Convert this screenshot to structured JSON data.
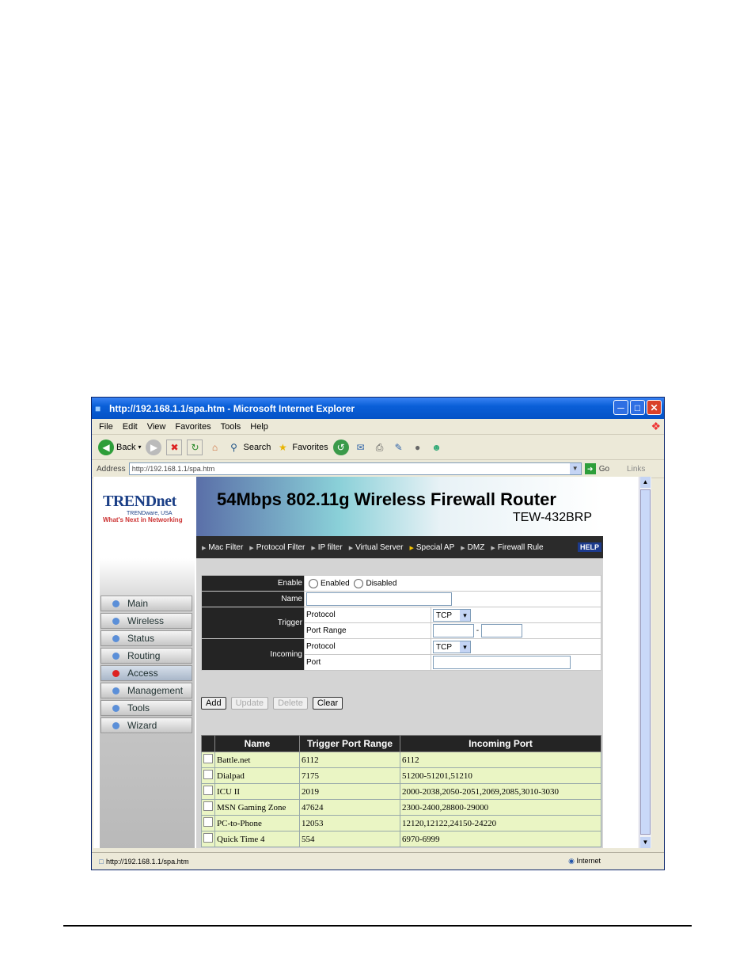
{
  "window": {
    "title": "http://192.168.1.1/spa.htm - Microsoft Internet Explorer"
  },
  "menu": [
    "File",
    "Edit",
    "View",
    "Favorites",
    "Tools",
    "Help"
  ],
  "toolbar": {
    "back": "Back",
    "search": "Search",
    "favorites": "Favorites"
  },
  "address": {
    "label": "Address",
    "url": "http://192.168.1.1/spa.htm",
    "go": "Go",
    "links": "Links"
  },
  "brand": {
    "name": "TRENDnet",
    "sub": "TRENDware, USA",
    "tagline": "What's Next in Networking"
  },
  "banner": {
    "title": "54Mbps 802.11g Wireless Firewall Router",
    "model": "TEW-432BRP"
  },
  "nav": [
    "Main",
    "Wireless",
    "Status",
    "Routing",
    "Access",
    "Management",
    "Tools",
    "Wizard"
  ],
  "tabs": [
    "Mac Filter",
    "Protocol Filter",
    "IP filter",
    "Virtual Server",
    "Special AP",
    "DMZ",
    "Firewall Rule"
  ],
  "help": "HELP",
  "form": {
    "enable_label": "Enable",
    "enabled": "Enabled",
    "disabled": "Disabled",
    "name_label": "Name",
    "trigger_label": "Trigger",
    "incoming_label": "Incoming",
    "protocol_label": "Protocol",
    "port_range_label": "Port Range",
    "port_label": "Port",
    "trigger_protocol": "TCP",
    "incoming_protocol": "TCP",
    "dash": "-"
  },
  "buttons": {
    "add": "Add",
    "update": "Update",
    "delete": "Delete",
    "clear": "Clear"
  },
  "list": {
    "headers": [
      "Name",
      "Trigger Port Range",
      "Incoming Port"
    ],
    "rows": [
      {
        "name": "Battle.net",
        "trigger": "6112",
        "incoming": "6112"
      },
      {
        "name": "Dialpad",
        "trigger": "7175",
        "incoming": "51200-51201,51210"
      },
      {
        "name": "ICU II",
        "trigger": "2019",
        "incoming": "2000-2038,2050-2051,2069,2085,3010-3030"
      },
      {
        "name": "MSN Gaming Zone",
        "trigger": "47624",
        "incoming": "2300-2400,28800-29000"
      },
      {
        "name": "PC-to-Phone",
        "trigger": "12053",
        "incoming": "12120,12122,24150-24220"
      },
      {
        "name": "Quick Time 4",
        "trigger": "554",
        "incoming": "6970-6999"
      }
    ]
  },
  "status": {
    "url": "http://192.168.1.1/spa.htm",
    "zone": "Internet"
  }
}
